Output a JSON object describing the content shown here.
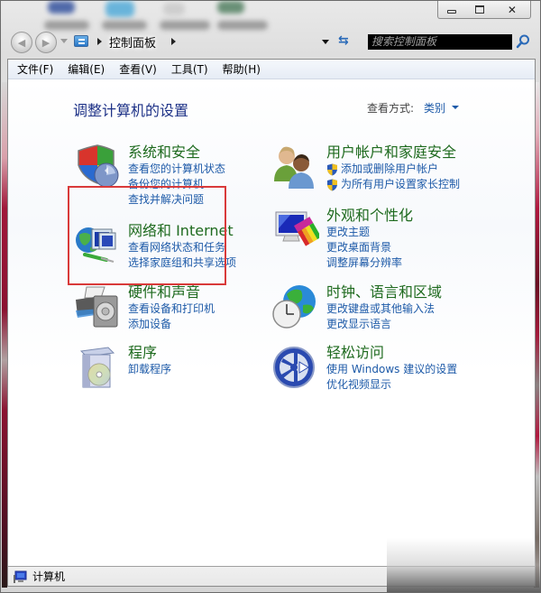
{
  "window": {
    "caption_buttons": {
      "minimize": "minimize",
      "maximize": "maximize",
      "close": "close"
    }
  },
  "nav": {
    "back_icon": "back-arrow-icon",
    "forward_icon": "forward-arrow-icon",
    "location_icon": "control-panel-icon",
    "breadcrumb": [
      "控制面板"
    ],
    "refresh_icon": "refresh-icon",
    "search_placeholder": "搜索控制面板",
    "search_icon": "search-icon"
  },
  "menu": [
    {
      "label": "文件(F)"
    },
    {
      "label": "编辑(E)"
    },
    {
      "label": "查看(V)"
    },
    {
      "label": "工具(T)"
    },
    {
      "label": "帮助(H)"
    }
  ],
  "main": {
    "title": "调整计算机的设置",
    "view_by_label": "查看方式:",
    "view_by_value": "类别",
    "categories_left": [
      {
        "icon": "security-shield-icon",
        "title": "系统和安全",
        "links": [
          "查看您的计算机状态",
          "备份您的计算机",
          "查找并解决问题"
        ],
        "highlighted": true
      },
      {
        "icon": "network-globe-icon",
        "title": "网络和 Internet",
        "links": [
          "查看网络状态和任务",
          "选择家庭组和共享选项"
        ]
      },
      {
        "icon": "printer-speaker-icon",
        "title": "硬件和声音",
        "links": [
          "查看设备和打印机",
          "添加设备"
        ]
      },
      {
        "icon": "program-box-icon",
        "title": "程序",
        "links": [
          "卸载程序"
        ]
      }
    ],
    "categories_right": [
      {
        "icon": "users-icon",
        "title": "用户帐户和家庭安全",
        "links": [
          "添加或删除用户帐户",
          "为所有用户设置家长控制"
        ],
        "uac_shield_links": true
      },
      {
        "icon": "monitor-palette-icon",
        "title": "外观和个性化",
        "links": [
          "更改主题",
          "更改桌面背景",
          "调整屏幕分辨率"
        ]
      },
      {
        "icon": "clock-globe-icon",
        "title": "时钟、语言和区域",
        "links": [
          "更改键盘或其他输入法",
          "更改显示语言"
        ]
      },
      {
        "icon": "ease-of-access-icon",
        "title": "轻松访问",
        "links": [
          "使用 Windows 建议的设置",
          "优化视频显示"
        ]
      }
    ]
  },
  "status": {
    "icon": "computer-icon",
    "text": "计算机"
  },
  "colors": {
    "category_title": "#1e6a1e",
    "link": "#1d5aa8",
    "page_title": "#1e3287",
    "highlight_box": "#d93a3a"
  }
}
